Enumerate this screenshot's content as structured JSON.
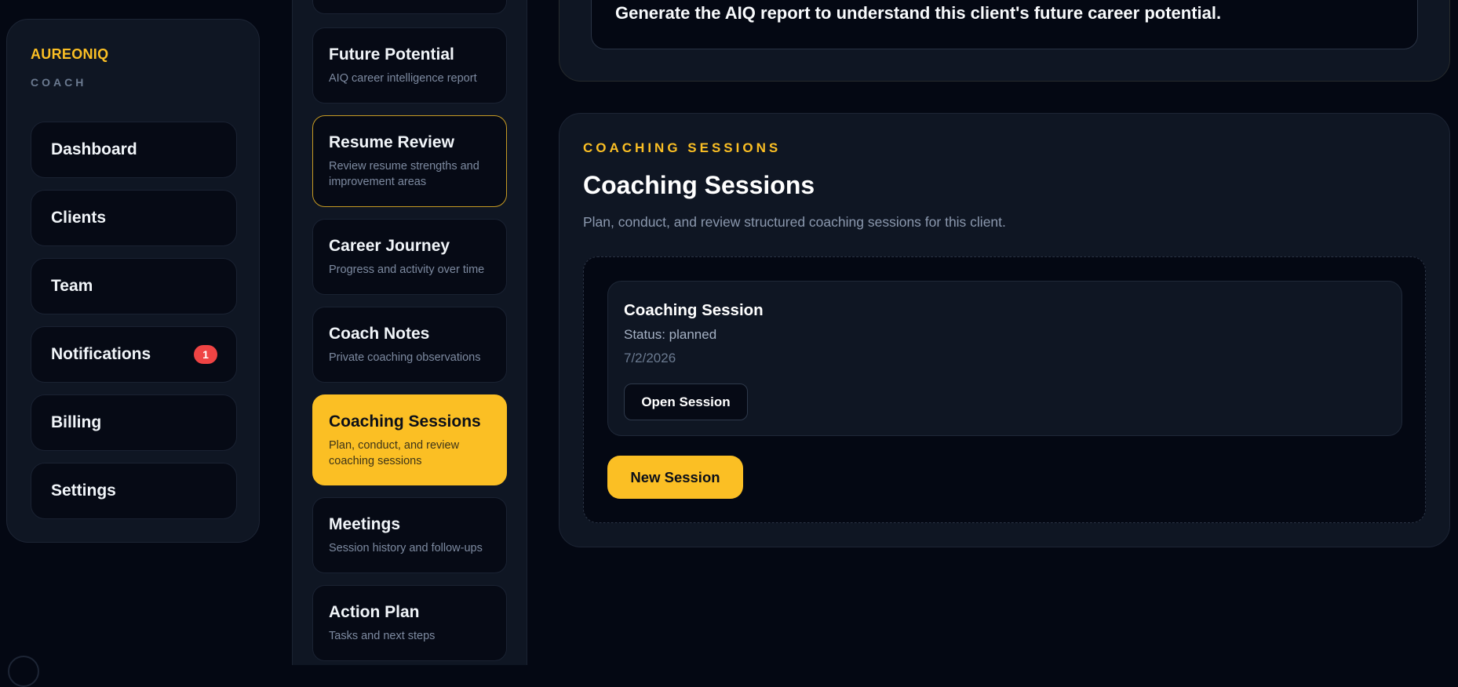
{
  "sidebar": {
    "brand": "AUREONIQ",
    "subtitle": "COACH",
    "items": [
      {
        "label": "Dashboard"
      },
      {
        "label": "Clients"
      },
      {
        "label": "Team"
      },
      {
        "label": "Notifications",
        "badge": "1"
      },
      {
        "label": "Billing"
      },
      {
        "label": "Settings"
      }
    ]
  },
  "sections": [
    {
      "title": "Future Potential",
      "desc": "AIQ career intelligence report"
    },
    {
      "title": "Resume Review",
      "desc": "Review resume strengths and improvement areas"
    },
    {
      "title": "Career Journey",
      "desc": "Progress and activity over time"
    },
    {
      "title": "Coach Notes",
      "desc": "Private coaching observations"
    },
    {
      "title": "Coaching Sessions",
      "desc": "Plan, conduct, and review coaching sessions"
    },
    {
      "title": "Meetings",
      "desc": "Session history and follow-ups"
    },
    {
      "title": "Action Plan",
      "desc": "Tasks and next steps"
    }
  ],
  "report": {
    "message": "Generate the AIQ report to understand this client's future career potential."
  },
  "sessions_panel": {
    "eyebrow": "COACHING SESSIONS",
    "title": "Coaching Sessions",
    "description": "Plan, conduct, and review structured coaching sessions for this client.",
    "session": {
      "title": "Coaching Session",
      "status": "Status: planned",
      "date": "7/2/2026",
      "open_label": "Open Session"
    },
    "new_label": "New Session"
  },
  "colors": {
    "accent": "#fbbf24",
    "background": "#040813",
    "panel": "#0f1623",
    "badge": "#ef4444"
  }
}
